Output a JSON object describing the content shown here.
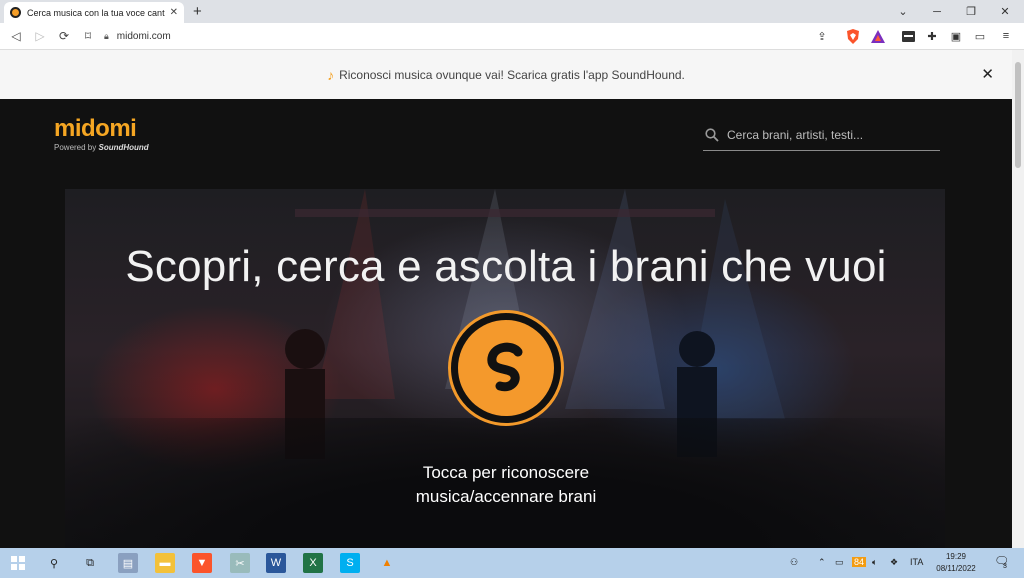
{
  "browser": {
    "tab_title": "Cerca musica con la tua voce cant",
    "url": "midomi.com"
  },
  "banner": {
    "text": "Riconosci musica ovunque vai! Scarica gratis l'app SoundHound."
  },
  "page": {
    "logo": "midomi",
    "powered_by_prefix": "Powered by",
    "powered_by_brand": "SoundHound",
    "search_placeholder": "Cerca brani, artisti, testi...",
    "headline": "Scopri, cerca e ascolta i brani che vuoi",
    "tap_line1": "Tocca per riconoscere",
    "tap_line2": "musica/accennare brani"
  },
  "taskbar": {
    "lang": "ITA",
    "time": "19:29",
    "date": "08/11/2022",
    "notification_count": "3",
    "tray_badge": "84"
  },
  "colors": {
    "accent": "#f4992c",
    "taskbar": "#b6d0ea"
  }
}
